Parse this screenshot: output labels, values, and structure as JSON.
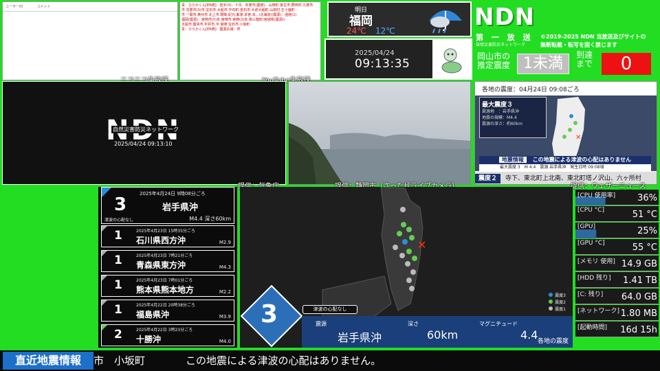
{
  "comments": {
    "nico_header": "ユーザーID　　　　コメント",
    "nico_caption": "ニコニコ生放送",
    "yt_caption": "YouTube生放送",
    "yt_lines": [
      "青：ひらかくん[ER統]：岩手(3)：ド月．石巻市(震度)：山田町.宮古市.野田村.久慈市",
      "市 花巻市(3)市.宝石市.大船市.平石町.釜石市.大倉大船町.山田村.五十嵐町",
      "市 一関市.奥州市.北上市.曖昧.紀元.紫波.本宮.本...(北海道)(震源)：函館(1)",
      "福岡(震源)：宮崎市(5)本.宮崎市.宮崎(3)本.南三陸町(宮城県(震源))",
      "大船市.震央市.平井市.平.宮崎.宝石市.小坂町",
      "青：ひらかくん[ER統]：震源広域：然"
    ]
  },
  "weather": {
    "label": "明日",
    "city": "福岡",
    "high": "24℃",
    "low": "12℃"
  },
  "clock": {
    "date": "2025/04/24",
    "time": "09:13:35"
  },
  "brand": {
    "logo": "NDN",
    "sub1": "第 一 放 送",
    "sub2": "自然災害防災ネットワーク",
    "copy1": "©2019-2025 NDN 当放送及びサイトの",
    "copy2": "無断転載・転写を固く禁じます",
    "est_label_1": "岡山市の",
    "est_label_2": "推定震度",
    "est_value": "1未満",
    "arrival_label_1": "到達",
    "arrival_label_2": "まで",
    "arrival_value": "0"
  },
  "ndnlive": {
    "logo": "NDN",
    "sub": "自然災害防災ネットワーク",
    "datetime": "2025/04/24 09:13:10",
    "caption": "提供：気象庁"
  },
  "camera": {
    "caption": "提供：静岡市（さった峠ライブカメラ）"
  },
  "regional": {
    "header": "各地の震度：04月24日 09:08ごろ",
    "max_label": "最大震度３",
    "rows": [
      "震源地　：岩手県沖",
      "地震の規模：M4.4",
      "震源の深さ：約60km"
    ],
    "strip": "この地震による津波の心配はありません",
    "strip2": "最大震度 3　M 4.4　震源 岩手県沖　発生日時 09:08頃",
    "tag": "地震情報",
    "bottom_label": "震度２",
    "bottom_text": "寺下、東北町上北南、東北町塔ノ沢山、六ヶ所村",
    "caption": "提供：ウェザーニュース"
  },
  "quakes": {
    "top": {
      "intensity": "3",
      "datetime": "2025年4月24日 9時08分ごろ",
      "place": "岩手県沖",
      "tsunami": "津波の心配なし",
      "mag": "M4.4 深さ60km"
    },
    "items": [
      {
        "intensity": "1",
        "datetime": "2025年4月23日 15時35分ごろ",
        "place": "石川県西方沖",
        "mag": "M2.9"
      },
      {
        "intensity": "1",
        "datetime": "2025年4月23日 7時21分ごろ",
        "place": "青森県東方沖",
        "mag": "M4.3"
      },
      {
        "intensity": "1",
        "datetime": "2025年4月23日 7時01分ごろ",
        "place": "熊本県熊本地方",
        "mag": "M2.2"
      },
      {
        "intensity": "1",
        "datetime": "2025年4月22日 20時38分ごろ",
        "place": "福島県沖",
        "mag": "M3.9"
      },
      {
        "intensity": "2",
        "datetime": "2025年4月22日 3時23分ごろ",
        "place": "十勝沖",
        "mag": "M4.0"
      }
    ]
  },
  "mainmap": {
    "intensity": "3",
    "tsunami": "津波の心配なし",
    "epicenter_label": "震源",
    "epicenter": "岩手県沖",
    "depth_label": "深さ",
    "depth": "60km",
    "mag_label": "マグニチュード",
    "mag": "4.4",
    "footer": "各地の震度",
    "legend": [
      "震度3",
      "震度2",
      "震度1"
    ],
    "colors": {
      "s3": "#2b8fd8",
      "s2": "#66cc55",
      "s1": "#bbbbbb",
      "epicenter": "#ff3300"
    }
  },
  "stats": [
    {
      "key": "[CPU 使用率]",
      "value": "36%",
      "fill": 0.36
    },
    {
      "key": "[CPU °C]",
      "value": "51 °C"
    },
    {
      "key": "[GPU]",
      "value": "25%",
      "fill": 0.25
    },
    {
      "key": "[GPU °C]",
      "value": "55 °C"
    },
    {
      "key": "[メモリ 使用]",
      "value": "14.9 GB"
    },
    {
      "key": "[HDD 残り]",
      "value": "1.41 TB"
    },
    {
      "key": "[C: 残り]",
      "value": "64.0 GB"
    },
    {
      "key": "[ネットワーク]",
      "value": "1.80 MB"
    },
    {
      "key": "[起動時間]",
      "value": "16d 15h"
    }
  ],
  "ticker": {
    "label": "直近地震情報",
    "text1": "市　小坂町",
    "text2": "この地震による津波の心配はありません。"
  }
}
